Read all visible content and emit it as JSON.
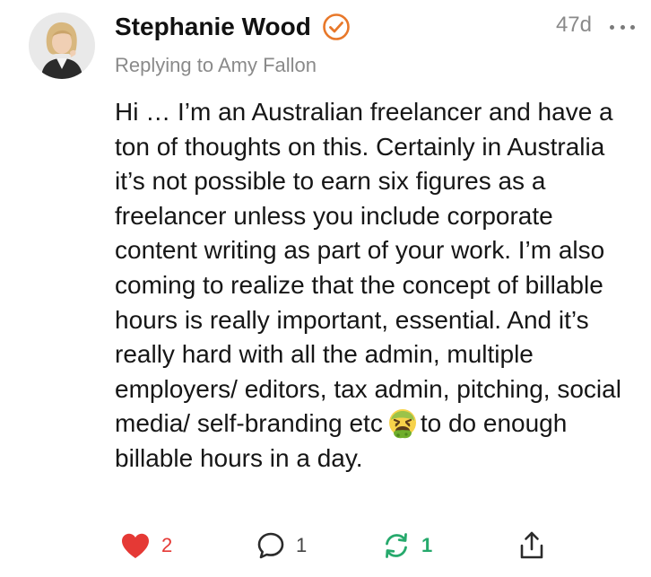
{
  "comment": {
    "author": "Stephanie Wood",
    "timestamp": "47d",
    "reply_to": "Replying to Amy Fallon",
    "body_before_emoji": "Hi … I’m an Australian freelancer and have a ton of thoughts on this. Certainly in Australia it’s not possible to earn six figures as a freelancer unless you include corporate content writing as part of your work. I’m also coming to realize that the concept of billable hours is really important, essential. And it’s really hard with all the admin, multiple employers/ editors, tax admin, pitching, social media/ self-branding etc",
    "emoji": "nauseated-face-emoji",
    "body_after_emoji": "to do enough billable hours in a day."
  },
  "actions": {
    "likes": "2",
    "replies": "1",
    "restacks": "1"
  },
  "icons": {
    "verified": "verified-check-icon",
    "more": "more-options-icon",
    "like": "heart-icon",
    "reply": "speech-bubble-icon",
    "restack": "restack-arrows-icon",
    "share": "share-icon"
  },
  "colors": {
    "verified": "#e8782a",
    "like": "#e53935",
    "restack": "#26a96c",
    "meta_text": "#8a8a8a"
  }
}
